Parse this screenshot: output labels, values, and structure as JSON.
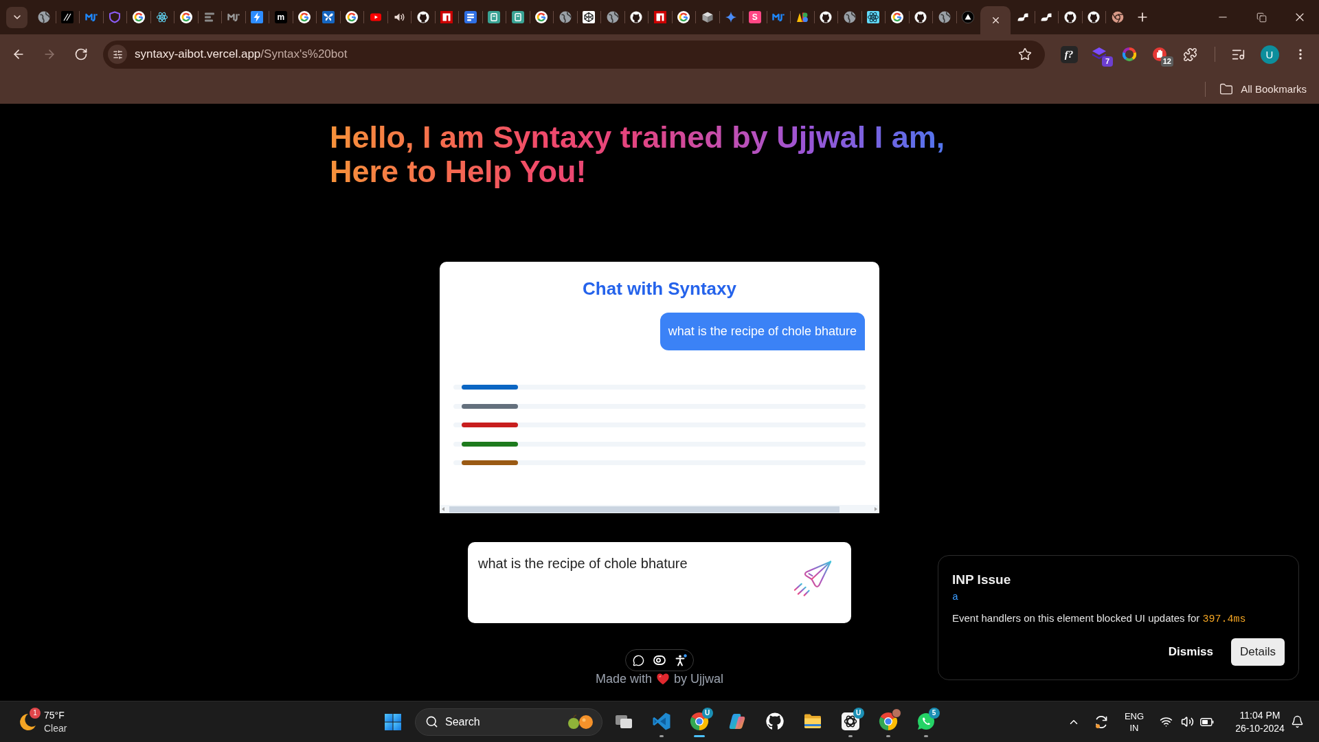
{
  "browser": {
    "tabs": [
      {
        "kind": "globe",
        "selected": false
      },
      {
        "kind": "slash",
        "selected": false
      },
      {
        "kind": "zigzag",
        "selected": false
      },
      {
        "kind": "shield",
        "selected": false
      },
      {
        "kind": "google",
        "selected": false
      },
      {
        "kind": "atom",
        "selected": false
      },
      {
        "kind": "google",
        "selected": false
      },
      {
        "kind": "lines",
        "selected": false
      },
      {
        "kind": "zigzagmono",
        "selected": false
      },
      {
        "kind": "bolt",
        "selected": false
      },
      {
        "kind": "letter",
        "letter": "m",
        "color": "#000000",
        "selected": false
      },
      {
        "kind": "google",
        "selected": false
      },
      {
        "kind": "butterfly",
        "selected": false
      },
      {
        "kind": "google",
        "selected": false
      },
      {
        "kind": "play",
        "selected": false
      },
      {
        "kind": "audio",
        "selected": false
      },
      {
        "kind": "octocat",
        "selected": false
      },
      {
        "kind": "notch",
        "selected": false
      },
      {
        "kind": "form",
        "selected": false
      },
      {
        "kind": "document",
        "selected": false
      },
      {
        "kind": "document",
        "selected": false
      },
      {
        "kind": "google",
        "selected": false
      },
      {
        "kind": "globe",
        "selected": false
      },
      {
        "kind": "cubeoutline",
        "selected": false
      },
      {
        "kind": "globe",
        "selected": false
      },
      {
        "kind": "octocat",
        "selected": false
      },
      {
        "kind": "notch",
        "selected": false
      },
      {
        "kind": "google",
        "selected": false
      },
      {
        "kind": "box",
        "selected": false
      },
      {
        "kind": "sparkle",
        "selected": false
      },
      {
        "kind": "letter",
        "letter": "S",
        "color": "#ff4785",
        "selected": false
      },
      {
        "kind": "zigzag",
        "selected": false
      },
      {
        "kind": "shapes",
        "selected": false
      },
      {
        "kind": "octocat",
        "selected": false
      },
      {
        "kind": "globe",
        "selected": false
      },
      {
        "kind": "atomtile",
        "selected": false
      },
      {
        "kind": "google",
        "selected": false
      },
      {
        "kind": "octocat",
        "selected": false
      },
      {
        "kind": "globe",
        "selected": false
      },
      {
        "kind": "triangle",
        "selected": false
      },
      {
        "selected": true
      },
      {
        "kind": "brush",
        "selected": false
      },
      {
        "kind": "brush",
        "selected": false
      },
      {
        "kind": "octocat",
        "selected": false
      },
      {
        "kind": "octocat",
        "selected": false
      },
      {
        "kind": "aperture",
        "selected": false
      }
    ],
    "navigation": [
      {
        "kind": "back",
        "disabled": false
      },
      {
        "kind": "forward",
        "disabled": true
      },
      {
        "kind": "reload",
        "disabled": false
      }
    ],
    "address_bar": {
      "host": "syntaxy-aibot.vercel.app",
      "path": "/Syntax's%20bot"
    },
    "extensions": [
      {
        "kind": "formula",
        "label": "f?"
      },
      {
        "kind": "stack",
        "badge": "7"
      },
      {
        "kind": "ring"
      },
      {
        "kind": "hand",
        "badge": "12"
      },
      {
        "kind": "puzzle"
      }
    ],
    "profile": {
      "initial": "U"
    },
    "bookmarks_bar": {
      "label": "All Bookmarks"
    }
  },
  "page": {
    "heading": "Hello, I am Syntaxy trained by Ujjwal I am, Here to Help You!",
    "chat": {
      "title": "Chat with Syntaxy",
      "messages": [
        {
          "kind": "user",
          "text": "what is the recipe of chole bhature"
        }
      ],
      "loader": [
        {
          "color": "#0b66c3"
        },
        {
          "color": "#64707d"
        },
        {
          "color": "#c81e1e"
        },
        {
          "color": "#1d7a1d"
        },
        {
          "color": "#9a5a14"
        }
      ]
    },
    "composer": {
      "value": "what is the recipe of chole bhature"
    },
    "footer": {
      "before": "Made with",
      "after": "by Ujjwal"
    }
  },
  "inp_toast": {
    "title": "INP Issue",
    "element": "a",
    "message": "Event handlers on this element blocked UI updates for",
    "duration": "397.4ms",
    "buttons": [
      {
        "kind": "text",
        "label": "Dismiss"
      },
      {
        "kind": "filled",
        "label": "Details"
      }
    ]
  },
  "taskbar": {
    "weather": {
      "badge": "1",
      "temperature": "75°F",
      "condition": "Clear"
    },
    "search": {
      "label": "Search"
    },
    "apps": [
      {
        "kind": "taskview",
        "running": false,
        "selected": false
      },
      {
        "kind": "editor",
        "running": true,
        "selected": false
      },
      {
        "kind": "chrome",
        "running": true,
        "selected": true,
        "badge": "U"
      },
      {
        "kind": "copilot",
        "running": false,
        "selected": false
      },
      {
        "kind": "github",
        "running": false,
        "selected": false
      },
      {
        "kind": "folder",
        "running": false,
        "selected": false
      },
      {
        "kind": "chatgpt",
        "running": true,
        "selected": false,
        "badge": "U"
      },
      {
        "kind": "chromeprofile",
        "running": true,
        "selected": false
      },
      {
        "kind": "whatsapp",
        "running": true,
        "selected": false,
        "badge": "5"
      }
    ],
    "language": {
      "code": "ENG",
      "region": "IN"
    },
    "clock": {
      "time": "11:04 PM",
      "date": "26-10-2024"
    }
  }
}
